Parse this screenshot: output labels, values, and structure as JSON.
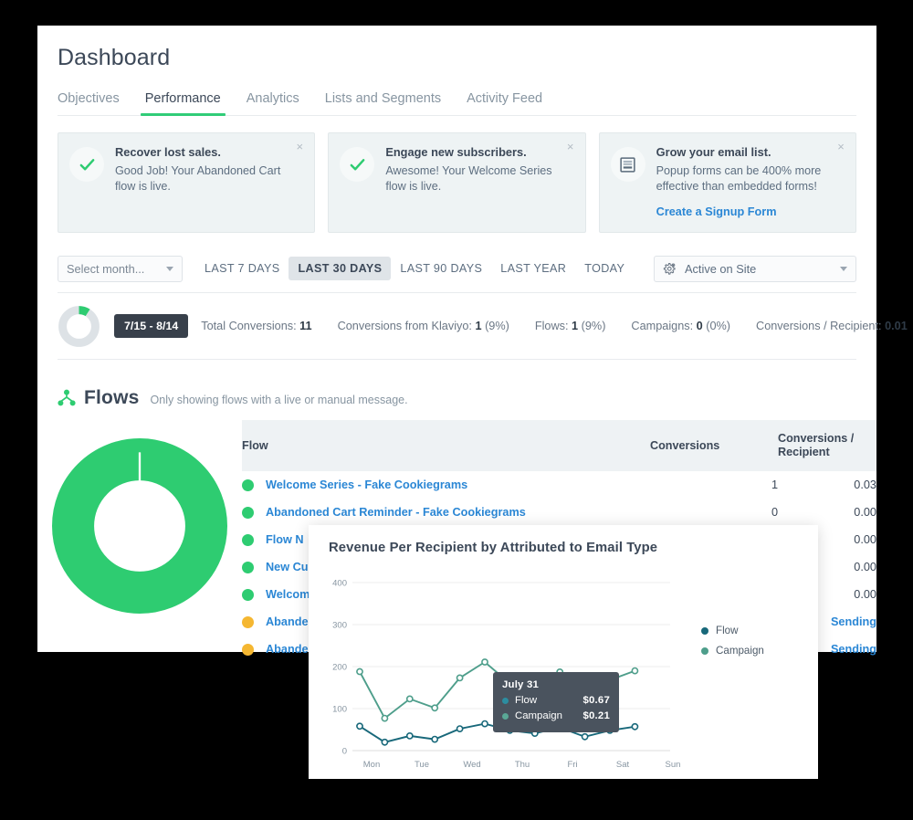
{
  "header": {
    "title": "Dashboard",
    "tabs": [
      {
        "label": "Objectives",
        "active": false
      },
      {
        "label": "Performance",
        "active": true
      },
      {
        "label": "Analytics",
        "active": false
      },
      {
        "label": "Lists and Segments",
        "active": false
      },
      {
        "label": "Activity Feed",
        "active": false
      }
    ]
  },
  "cards": [
    {
      "icon": "check-icon",
      "title": "Recover lost sales.",
      "text": "Good Job! Your Abandoned Cart flow is live.",
      "link": "",
      "close": "×"
    },
    {
      "icon": "check-icon",
      "title": "Engage new subscribers.",
      "text": "Awesome! Your Welcome Series flow is live.",
      "link": "",
      "close": "×"
    },
    {
      "icon": "signup-form-icon",
      "title": "Grow your email list.",
      "text": "Popup forms can be 400% more effective than embedded forms!",
      "link": "Create a Signup Form",
      "close": "×"
    }
  ],
  "filters": {
    "select_month_label": "Select month...",
    "ranges": [
      {
        "label": "LAST 7 DAYS",
        "active": false
      },
      {
        "label": "LAST 30 DAYS",
        "active": true
      },
      {
        "label": "LAST 90 DAYS",
        "active": false
      },
      {
        "label": "LAST YEAR",
        "active": false
      },
      {
        "label": "TODAY",
        "active": false
      }
    ],
    "metric_select_label": "Active on Site"
  },
  "stats": {
    "date_range": "7/15 - 8/14",
    "donut_percent": 9,
    "items": [
      {
        "label": "Total Conversions:",
        "value": "11",
        "suffix": ""
      },
      {
        "label": "Conversions from Klaviyo:",
        "value": "1",
        "suffix": " (9%)"
      },
      {
        "label": "Flows:",
        "value": "1",
        "suffix": " (9%)"
      },
      {
        "label": "Campaigns:",
        "value": "0",
        "suffix": " (0%)"
      },
      {
        "label": "Conversions / Recipient:",
        "value": "0.01",
        "suffix": ""
      }
    ]
  },
  "flows": {
    "icon": "flows-icon",
    "title": "Flows",
    "subtitle": "Only showing flows with a live or manual message.",
    "donut_color": "#2ecc71",
    "columns": {
      "flow": "Flow",
      "conversions": "Conversions",
      "conversions_per_recipient": "Conversions /\nRecipient",
      "cr_line1": "Conversions /",
      "cr_line2": "Recipient"
    },
    "rows": [
      {
        "status": "green",
        "name": "Welcome Series - Fake Cookiegrams",
        "conversions": "1",
        "cr": "0.03"
      },
      {
        "status": "green",
        "name": "Abandoned Cart Reminder - Fake Cookiegrams",
        "conversions": "0",
        "cr": "0.00"
      },
      {
        "status": "green",
        "name": "Flow N",
        "conversions": "",
        "cr": "0.00"
      },
      {
        "status": "green",
        "name": "New Cu",
        "conversions": "",
        "cr": "0.00"
      },
      {
        "status": "green",
        "name": "Welcom",
        "conversions": "",
        "cr": "0.00"
      },
      {
        "status": "yellow",
        "name": "Abande",
        "conversions": "",
        "cr": "Sending"
      },
      {
        "status": "yellow",
        "name": "Abande",
        "conversions": "",
        "cr": "Sending"
      }
    ]
  },
  "chart_data": {
    "type": "line",
    "title": "Revenue Per Recipient by Attributed to Email Type",
    "xlabel": "",
    "ylabel": "",
    "ylim": [
      0,
      450
    ],
    "yticks": [
      0,
      100,
      200,
      300,
      400
    ],
    "grid": true,
    "legend_position": "right",
    "x": [
      "Mon",
      "",
      "Tue",
      "",
      "Wed",
      "",
      "Thu",
      "",
      "Fri",
      "",
      "Sat",
      "",
      "Sun",
      ""
    ],
    "tick_labels": [
      "Mon",
      "Tue",
      "Wed",
      "Thu",
      "Fri",
      "Sat",
      "Sun"
    ],
    "series": [
      {
        "name": "Flow",
        "color": "#18687a",
        "values": [
          58,
          20,
          35,
          27,
          52,
          64,
          48,
          41,
          55,
          33,
          48,
          57
        ]
      },
      {
        "name": "Campaign",
        "color": "#4e9e8b",
        "values": [
          188,
          77,
          123,
          102,
          173,
          211,
          160,
          130,
          187,
          119,
          168,
          190
        ]
      }
    ],
    "tooltip": {
      "date": "July 31",
      "rows": [
        {
          "label": "Flow",
          "value": "$0.67",
          "color": "#18687a"
        },
        {
          "label": "Campaign",
          "value": "$0.21",
          "color": "#4e9e8b"
        }
      ]
    }
  },
  "colors": {
    "accent_green": "#31cc78",
    "link_blue": "#2b87d5",
    "dark_chip": "#38404b",
    "text_dark": "#3c4858",
    "text_muted": "#8795a1"
  }
}
